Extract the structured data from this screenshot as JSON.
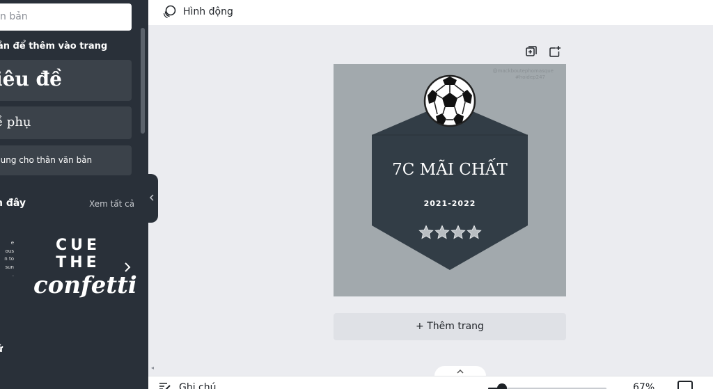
{
  "sidebar": {
    "search_placeholder": "n bản",
    "click_to_add_heading": "ản để thêm vào trang",
    "text_styles": {
      "heading": "iêu đề",
      "subheading": "ề phụ",
      "body": "dung cho thân văn bản"
    },
    "recent_heading": "n đây",
    "see_all": "Xem tất cả",
    "partial_card_lines": [
      "e",
      "ous",
      "n to",
      "sun",
      "."
    ],
    "confetti_card": {
      "line1": "CUE THE",
      "line2": "confetti"
    },
    "fonts_heading": "ữ"
  },
  "topbar": {
    "animate_label": "Hình động"
  },
  "page_tools": {
    "duplicate_icon": "duplicate-page-icon",
    "add_icon": "add-page-icon"
  },
  "design": {
    "watermark_line1": "@mackboutephomasque",
    "watermark_line2": "#hoidep247",
    "title": "7C MÃI CHẤT",
    "year": "2021-2022",
    "stars_count": 4,
    "colors": {
      "background": "#a2a9ad",
      "badge": "#323d46",
      "text": "#ffffff"
    }
  },
  "add_page_label": "+ Thêm trang",
  "bottombar": {
    "notes_label": "Ghi chú",
    "zoom_value": "67%",
    "zoom_fraction": 0.12
  }
}
